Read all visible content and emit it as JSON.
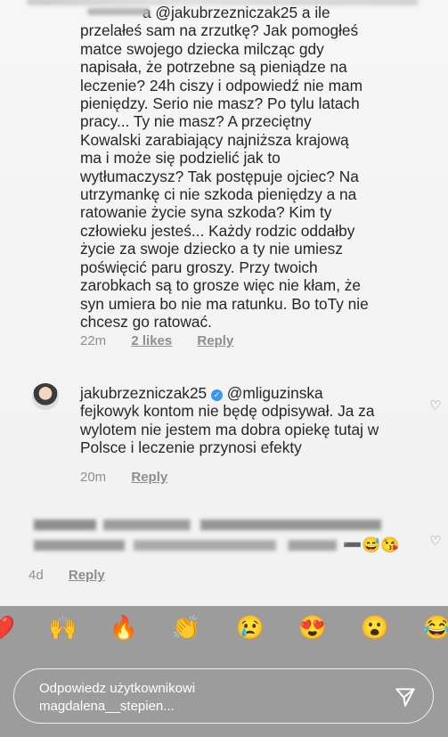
{
  "comments": [
    {
      "text": "a @jakubrzezniczak25 a ile przelałeś sam na zrzutkę? Jak pomogłeś matce swojego dziecka milcząc gdy napisała, że potrzebne są pieniądze na leczenie? 24h ciszy i odpowiedź nie mam pieniędzy. Serio nie masz? Po tylu latach pracy... Ty nie masz? A przeciętny Kowalski zarabiający najniższa krajową ma i może się podzielić jak to wytłumaczysz? Tak postępuje ojciec? Na utrzymankę ci nie szkoda pieniędzy a na ratowanie życie syna szkoda? Kim ty człowieku jesteś... Każdy rodzic oddałby życie za swoje dziecko a ty nie umiesz poświęcić paru groszy. Przy twoich zarobkach są to grosze więc nie kłam, że syn umiera bo nie ma ratunku. Bo toTy nie chcesz go ratować.",
      "time": "22m",
      "likes": "2 likes",
      "reply": "Reply"
    },
    {
      "username": "jakubrzezniczak25",
      "mention": "@mliguzinska",
      "text": "fejkowyk kontom nie będę odpisywał. Ja za wylotem nie jestem ma dobra opiekę tutaj w Polsce i leczenie przynosi efekty",
      "time": "20m",
      "reply": "Reply"
    },
    {
      "time": "4d",
      "reply": "Reply"
    }
  ],
  "emojis": [
    "❤️",
    "🙌",
    "🔥",
    "👏",
    "😢",
    "😍",
    "😮",
    "😂"
  ],
  "reply_bar": {
    "placeholder_line1": "Odpowiedz użytkownikowi",
    "placeholder_line2": "magdalena__stepien..."
  },
  "icons": [
    "heart-icon",
    "verified-icon",
    "send-icon"
  ]
}
